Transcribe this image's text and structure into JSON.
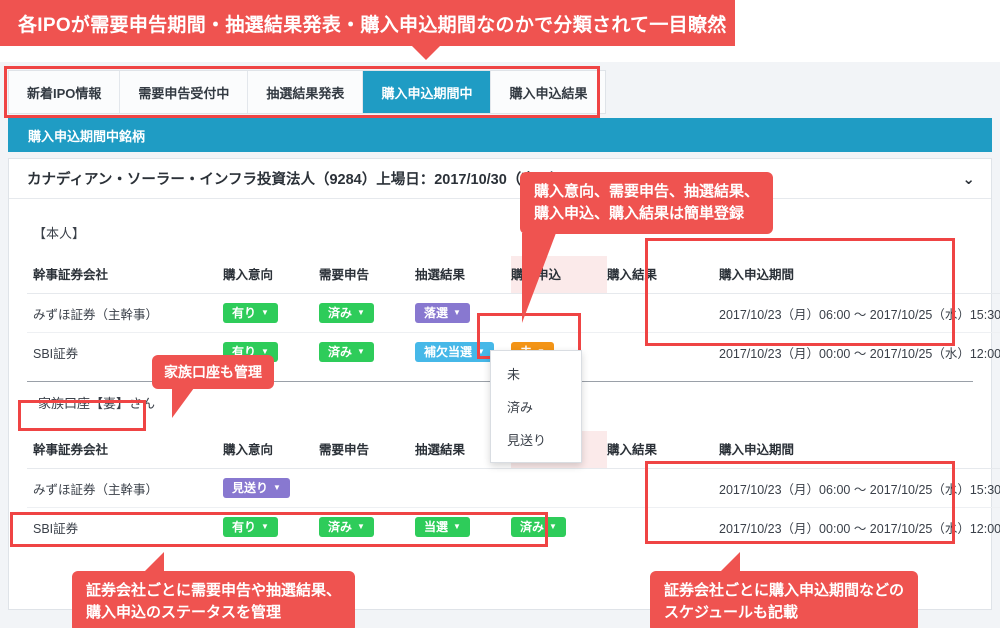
{
  "banner": {
    "text": "各IPOが需要申告期間・抽選結果発表・購入申込期間なのかで分類されて一目瞭然"
  },
  "tabs": [
    {
      "label": "新着IPO情報",
      "active": false
    },
    {
      "label": "需要申告受付中",
      "active": false
    },
    {
      "label": "抽選結果発表",
      "active": false
    },
    {
      "label": "購入申込期間中",
      "active": true
    },
    {
      "label": "購入申込結果",
      "active": false
    }
  ],
  "section_header": {
    "title": "購入申込期間中銘柄"
  },
  "card": {
    "title": "カナディアン・ソーラー・インフラ投資法人（9284）上場日：2017/10/30（東イ）",
    "collapse_icon": "chevron-down-icon",
    "chevron": "⌄"
  },
  "columns": {
    "firm": "幹事証券会社",
    "intent": "購入意向",
    "demand": "需要申告",
    "lottery": "抽選結果",
    "apply": "購入申込",
    "result": "購入結果",
    "period": "購入申込期間"
  },
  "owner_self": {
    "label": "【本人】",
    "rows": [
      {
        "firm": "みずほ証券（主幹事）",
        "intent": {
          "label": "有り",
          "color": "b-green"
        },
        "demand": {
          "label": "済み",
          "color": "b-green"
        },
        "lottery": {
          "label": "落選",
          "color": "b-purple"
        },
        "apply": null,
        "result": null,
        "period": "2017/10/23（月）06:00 〜 2017/10/25（水）15:30"
      },
      {
        "firm": "SBI証券",
        "intent": {
          "label": "有り",
          "color": "b-green"
        },
        "demand": {
          "label": "済み",
          "color": "b-green"
        },
        "lottery": {
          "label": "補欠当選",
          "color": "b-blue"
        },
        "apply": {
          "label": "未",
          "color": "b-orange"
        },
        "result": null,
        "period": "2017/10/23（月）00:00 〜 2017/10/25（水）12:00"
      }
    ]
  },
  "owner_family": {
    "label": "家族口座【妻】さん",
    "rows": [
      {
        "firm": "みずほ証券（主幹事）",
        "intent": {
          "label": "見送り",
          "color": "b-purple"
        },
        "demand": null,
        "lottery": null,
        "apply": null,
        "result": null,
        "period": "2017/10/23（月）06:00 〜 2017/10/25（水）15:30"
      },
      {
        "firm": "SBI証券",
        "intent": {
          "label": "有り",
          "color": "b-green"
        },
        "demand": {
          "label": "済み",
          "color": "b-green"
        },
        "lottery": {
          "label": "当選",
          "color": "b-green"
        },
        "apply": {
          "label": "済み",
          "color": "b-green"
        },
        "result": null,
        "period": "2017/10/23（月）00:00 〜 2017/10/25（水）12:00"
      }
    ]
  },
  "dropdown": {
    "items": [
      "未",
      "済み",
      "見送り"
    ]
  },
  "callouts": {
    "status_register": "購入意向、需要申告、抽選結果、\n購入申込、購入結果は簡単登録",
    "status_register_line1": "購入意向、需要申告、抽選結果、",
    "status_register_line2": "購入申込、購入結果は簡単登録",
    "family": "家族口座も管理",
    "status_manage_line1": "証券会社ごとに需要申告や抽選結果、",
    "status_manage_line2": "購入申込のステータスを管理",
    "schedule_line1": "証券会社ごとに購入申込期間などの",
    "schedule_line2": "スケジュールも記載"
  },
  "colors": {
    "banner_red": "#ef5350",
    "accent_blue": "#1f9cc4",
    "annotation_red": "#ef4444",
    "green": "#2ecc5a",
    "purple": "#8878d0",
    "light_blue": "#46b8e8",
    "orange": "#f39416"
  }
}
